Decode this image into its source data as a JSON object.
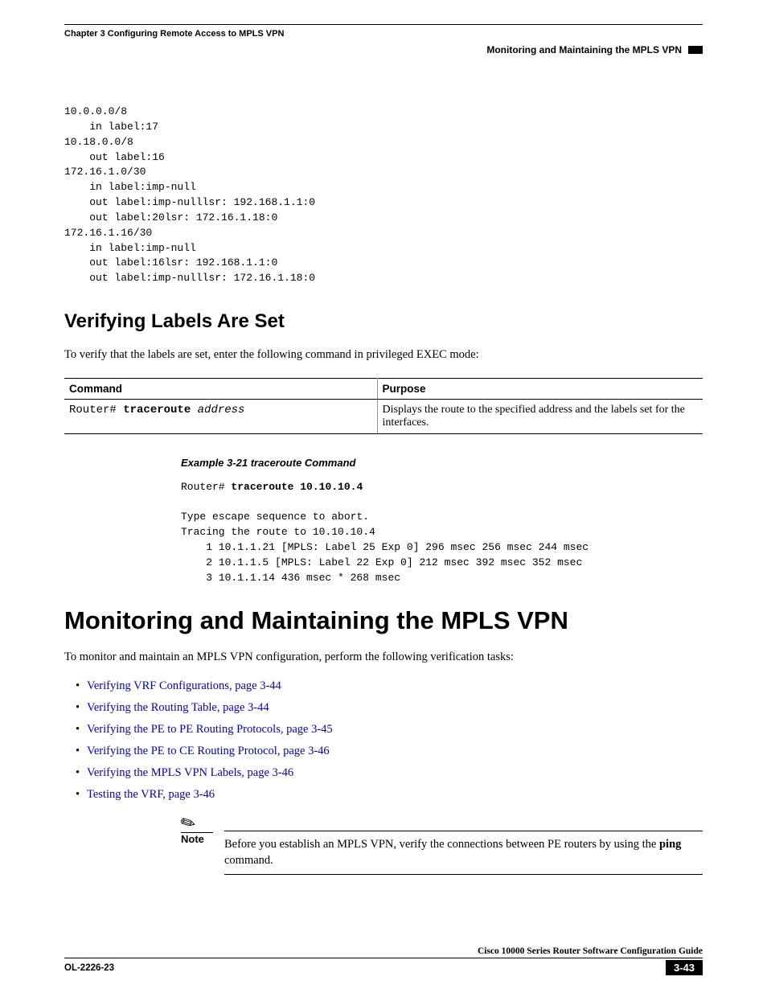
{
  "header": {
    "chapter": "Chapter 3    Configuring Remote Access to MPLS VPN",
    "section": "Monitoring and Maintaining the MPLS VPN"
  },
  "code1_lines": [
    "10.0.0.0/8",
    "    in label:17",
    "10.18.0.0/8",
    "    out label:16",
    "172.16.1.0/30",
    "    in label:imp-null",
    "    out label:imp-nulllsr: 192.168.1.1:0",
    "    out label:20lsr: 172.16.1.18:0",
    "172.16.1.16/30",
    "    in label:imp-null",
    "    out label:16lsr: 192.168.1.1:0",
    "    out label:imp-nulllsr: 172.16.1.18:0"
  ],
  "h2_1": "Verifying Labels Are Set",
  "p1": "To verify that the labels are set, enter the following command in privileged EXEC mode:",
  "table": {
    "headers": {
      "c1": "Command",
      "c2": "Purpose"
    },
    "row": {
      "cmd_prompt": "Router# ",
      "cmd_bold": "traceroute",
      "cmd_italic": " address",
      "purpose": "Displays the route to the specified address and the labels set for the interfaces."
    }
  },
  "example_caption": "Example 3-21   traceroute Command",
  "code2": {
    "line1_prompt": "Router# ",
    "line1_bold": "traceroute 10.10.10.4",
    "rest": [
      "",
      "Type escape sequence to abort.",
      "Tracing the route to 10.10.10.4",
      "    1 10.1.1.21 [MPLS: Label 25 Exp 0] 296 msec 256 msec 244 msec",
      "    2 10.1.1.5 [MPLS: Label 22 Exp 0] 212 msec 392 msec 352 msec",
      "    3 10.1.1.14 436 msec * 268 msec"
    ]
  },
  "h1_1": "Monitoring and Maintaining the MPLS VPN",
  "p2": "To monitor and maintain an MPLS VPN configuration, perform the following verification tasks:",
  "links": [
    "Verifying VRF Configurations, page 3-44",
    "Verifying the Routing Table, page 3-44",
    "Verifying the PE to PE Routing Protocols, page 3-45",
    "Verifying the PE to CE Routing Protocol, page 3-46",
    "Verifying the MPLS VPN Labels, page 3-46",
    "Testing the VRF, page 3-46"
  ],
  "note": {
    "label": "Note",
    "text_pre": "Before you establish an MPLS VPN, verify the connections between PE routers by using the ",
    "text_bold": "ping",
    "text_post": " command."
  },
  "footer": {
    "guide": "Cisco 10000 Series Router Software Configuration Guide",
    "doc": "OL-2226-23",
    "page": "3-43"
  }
}
